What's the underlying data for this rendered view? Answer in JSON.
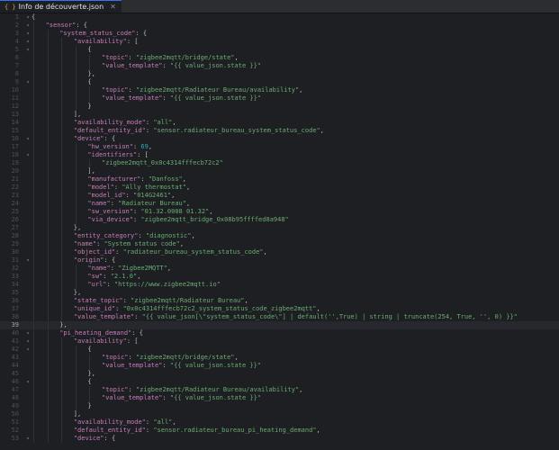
{
  "tab": {
    "icon": "{ }",
    "title": "Info de découverte.json",
    "close": "✕"
  },
  "editor": {
    "current_line": 39,
    "lines": [
      {
        "n": 1,
        "fold": "▾",
        "indent": 0,
        "tokens": [
          [
            "p",
            "{"
          ]
        ]
      },
      {
        "n": 2,
        "fold": "▾",
        "indent": 1,
        "tokens": [
          [
            "k",
            "\"sensor\""
          ],
          [
            "p",
            ": {"
          ]
        ]
      },
      {
        "n": 3,
        "fold": "▾",
        "indent": 2,
        "tokens": [
          [
            "k",
            "\"system_status_code\""
          ],
          [
            "p",
            ": {"
          ]
        ]
      },
      {
        "n": 4,
        "fold": "▾",
        "indent": 3,
        "tokens": [
          [
            "k",
            "\"availability\""
          ],
          [
            "p",
            ": ["
          ]
        ]
      },
      {
        "n": 5,
        "fold": "▾",
        "indent": 4,
        "tokens": [
          [
            "p",
            "{"
          ]
        ]
      },
      {
        "n": 6,
        "fold": "",
        "indent": 5,
        "tokens": [
          [
            "k",
            "\"topic\""
          ],
          [
            "p",
            ": "
          ],
          [
            "s",
            "\"zigbee2mqtt/bridge/state\""
          ],
          [
            "p",
            ","
          ]
        ]
      },
      {
        "n": 7,
        "fold": "",
        "indent": 5,
        "tokens": [
          [
            "k",
            "\"value_template\""
          ],
          [
            "p",
            ": "
          ],
          [
            "s",
            "\"{{ value_json.state }}\""
          ]
        ]
      },
      {
        "n": 8,
        "fold": "",
        "indent": 4,
        "tokens": [
          [
            "p",
            "},"
          ]
        ]
      },
      {
        "n": 9,
        "fold": "▾",
        "indent": 4,
        "tokens": [
          [
            "p",
            "{"
          ]
        ]
      },
      {
        "n": 10,
        "fold": "",
        "indent": 5,
        "tokens": [
          [
            "k",
            "\"topic\""
          ],
          [
            "p",
            ": "
          ],
          [
            "s",
            "\"zigbee2mqtt/Radiateur Bureau/availability\""
          ],
          [
            "p",
            ","
          ]
        ]
      },
      {
        "n": 11,
        "fold": "",
        "indent": 5,
        "tokens": [
          [
            "k",
            "\"value_template\""
          ],
          [
            "p",
            ": "
          ],
          [
            "s",
            "\"{{ value_json.state }}\""
          ]
        ]
      },
      {
        "n": 12,
        "fold": "",
        "indent": 4,
        "tokens": [
          [
            "p",
            "}"
          ]
        ]
      },
      {
        "n": 13,
        "fold": "",
        "indent": 3,
        "tokens": [
          [
            "p",
            "],"
          ]
        ]
      },
      {
        "n": 14,
        "fold": "",
        "indent": 3,
        "tokens": [
          [
            "k",
            "\"availability_mode\""
          ],
          [
            "p",
            ": "
          ],
          [
            "s",
            "\"all\""
          ],
          [
            "p",
            ","
          ]
        ]
      },
      {
        "n": 15,
        "fold": "",
        "indent": 3,
        "tokens": [
          [
            "k",
            "\"default_entity_id\""
          ],
          [
            "p",
            ": "
          ],
          [
            "s",
            "\"sensor.radiateur_bureau_system_status_code\""
          ],
          [
            "p",
            ","
          ]
        ]
      },
      {
        "n": 16,
        "fold": "▾",
        "indent": 3,
        "tokens": [
          [
            "k",
            "\"device\""
          ],
          [
            "p",
            ": {"
          ]
        ]
      },
      {
        "n": 17,
        "fold": "",
        "indent": 4,
        "tokens": [
          [
            "k",
            "\"hw_version\""
          ],
          [
            "p",
            ": "
          ],
          [
            "n",
            "69"
          ],
          [
            "p",
            ","
          ]
        ]
      },
      {
        "n": 18,
        "fold": "▾",
        "indent": 4,
        "tokens": [
          [
            "k",
            "\"identifiers\""
          ],
          [
            "p",
            ": ["
          ]
        ]
      },
      {
        "n": 19,
        "fold": "",
        "indent": 5,
        "tokens": [
          [
            "s",
            "\"zigbee2mqtt_0x0c4314fffecb72c2\""
          ]
        ]
      },
      {
        "n": 20,
        "fold": "",
        "indent": 4,
        "tokens": [
          [
            "p",
            "],"
          ]
        ]
      },
      {
        "n": 21,
        "fold": "",
        "indent": 4,
        "tokens": [
          [
            "k",
            "\"manufacturer\""
          ],
          [
            "p",
            ": "
          ],
          [
            "s",
            "\"Danfoss\""
          ],
          [
            "p",
            ","
          ]
        ]
      },
      {
        "n": 22,
        "fold": "",
        "indent": 4,
        "tokens": [
          [
            "k",
            "\"model\""
          ],
          [
            "p",
            ": "
          ],
          [
            "s",
            "\"Ally thermostat\""
          ],
          [
            "p",
            ","
          ]
        ]
      },
      {
        "n": 23,
        "fold": "",
        "indent": 4,
        "tokens": [
          [
            "k",
            "\"model_id\""
          ],
          [
            "p",
            ": "
          ],
          [
            "s",
            "\"014G2461\""
          ],
          [
            "p",
            ","
          ]
        ]
      },
      {
        "n": 24,
        "fold": "",
        "indent": 4,
        "tokens": [
          [
            "k",
            "\"name\""
          ],
          [
            "p",
            ": "
          ],
          [
            "s",
            "\"Radiateur Bureau\""
          ],
          [
            "p",
            ","
          ]
        ]
      },
      {
        "n": 25,
        "fold": "",
        "indent": 4,
        "tokens": [
          [
            "k",
            "\"sw_version\""
          ],
          [
            "p",
            ": "
          ],
          [
            "s",
            "\"01.32.0008 01.32\""
          ],
          [
            "p",
            ","
          ]
        ]
      },
      {
        "n": 26,
        "fold": "",
        "indent": 4,
        "tokens": [
          [
            "k",
            "\"via_device\""
          ],
          [
            "p",
            ": "
          ],
          [
            "s",
            "\"zigbee2mqtt_bridge_0x08b95ffffed8a948\""
          ]
        ]
      },
      {
        "n": 27,
        "fold": "",
        "indent": 3,
        "tokens": [
          [
            "p",
            "},"
          ]
        ]
      },
      {
        "n": 28,
        "fold": "",
        "indent": 3,
        "tokens": [
          [
            "k",
            "\"entity_category\""
          ],
          [
            "p",
            ": "
          ],
          [
            "s",
            "\"diagnostic\""
          ],
          [
            "p",
            ","
          ]
        ]
      },
      {
        "n": 29,
        "fold": "",
        "indent": 3,
        "tokens": [
          [
            "k",
            "\"name\""
          ],
          [
            "p",
            ": "
          ],
          [
            "s",
            "\"System status code\""
          ],
          [
            "p",
            ","
          ]
        ]
      },
      {
        "n": 30,
        "fold": "",
        "indent": 3,
        "tokens": [
          [
            "k",
            "\"object_id\""
          ],
          [
            "p",
            ": "
          ],
          [
            "s",
            "\"radiateur_bureau_system_status_code\""
          ],
          [
            "p",
            ","
          ]
        ]
      },
      {
        "n": 31,
        "fold": "▾",
        "indent": 3,
        "tokens": [
          [
            "k",
            "\"origin\""
          ],
          [
            "p",
            ": {"
          ]
        ]
      },
      {
        "n": 32,
        "fold": "",
        "indent": 4,
        "tokens": [
          [
            "k",
            "\"name\""
          ],
          [
            "p",
            ": "
          ],
          [
            "s",
            "\"Zigbee2MQTT\""
          ],
          [
            "p",
            ","
          ]
        ]
      },
      {
        "n": 33,
        "fold": "",
        "indent": 4,
        "tokens": [
          [
            "k",
            "\"sw\""
          ],
          [
            "p",
            ": "
          ],
          [
            "s",
            "\"2.1.0\""
          ],
          [
            "p",
            ","
          ]
        ]
      },
      {
        "n": 34,
        "fold": "",
        "indent": 4,
        "tokens": [
          [
            "k",
            "\"url\""
          ],
          [
            "p",
            ": "
          ],
          [
            "s",
            "\"https://www.zigbee2mqtt.io\""
          ]
        ]
      },
      {
        "n": 35,
        "fold": "",
        "indent": 3,
        "tokens": [
          [
            "p",
            "},"
          ]
        ]
      },
      {
        "n": 36,
        "fold": "",
        "indent": 3,
        "tokens": [
          [
            "k",
            "\"state_topic\""
          ],
          [
            "p",
            ": "
          ],
          [
            "s",
            "\"zigbee2mqtt/Radiateur Bureau\""
          ],
          [
            "p",
            ","
          ]
        ]
      },
      {
        "n": 37,
        "fold": "",
        "indent": 3,
        "tokens": [
          [
            "k",
            "\"unique_id\""
          ],
          [
            "p",
            ": "
          ],
          [
            "s",
            "\"0x0c4314fffecb72c2_system_status_code_zigbee2mqtt\""
          ],
          [
            "p",
            ","
          ]
        ]
      },
      {
        "n": 38,
        "fold": "",
        "indent": 3,
        "tokens": [
          [
            "k",
            "\"value_template\""
          ],
          [
            "p",
            ": "
          ],
          [
            "s",
            "\"{{ value_json[\\\"system_status_code\\\"] | default('',True) | string | truncate(254, True, '', 0) }}\""
          ]
        ]
      },
      {
        "n": 39,
        "fold": "",
        "indent": 2,
        "tokens": [
          [
            "p",
            "},"
          ]
        ]
      },
      {
        "n": 40,
        "fold": "▾",
        "indent": 2,
        "tokens": [
          [
            "k",
            "\"pi_heating_demand\""
          ],
          [
            "p",
            ": {"
          ]
        ]
      },
      {
        "n": 41,
        "fold": "▾",
        "indent": 3,
        "tokens": [
          [
            "k",
            "\"availability\""
          ],
          [
            "p",
            ": ["
          ]
        ]
      },
      {
        "n": 42,
        "fold": "▾",
        "indent": 4,
        "tokens": [
          [
            "p",
            "{"
          ]
        ]
      },
      {
        "n": 43,
        "fold": "",
        "indent": 5,
        "tokens": [
          [
            "k",
            "\"topic\""
          ],
          [
            "p",
            ": "
          ],
          [
            "s",
            "\"zigbee2mqtt/bridge/state\""
          ],
          [
            "p",
            ","
          ]
        ]
      },
      {
        "n": 44,
        "fold": "",
        "indent": 5,
        "tokens": [
          [
            "k",
            "\"value_template\""
          ],
          [
            "p",
            ": "
          ],
          [
            "s",
            "\"{{ value_json.state }}\""
          ]
        ]
      },
      {
        "n": 45,
        "fold": "",
        "indent": 4,
        "tokens": [
          [
            "p",
            "},"
          ]
        ]
      },
      {
        "n": 46,
        "fold": "▾",
        "indent": 4,
        "tokens": [
          [
            "p",
            "{"
          ]
        ]
      },
      {
        "n": 47,
        "fold": "",
        "indent": 5,
        "tokens": [
          [
            "k",
            "\"topic\""
          ],
          [
            "p",
            ": "
          ],
          [
            "s",
            "\"zigbee2mqtt/Radiateur Bureau/availability\""
          ],
          [
            "p",
            ","
          ]
        ]
      },
      {
        "n": 48,
        "fold": "",
        "indent": 5,
        "tokens": [
          [
            "k",
            "\"value_template\""
          ],
          [
            "p",
            ": "
          ],
          [
            "s",
            "\"{{ value_json.state }}\""
          ]
        ]
      },
      {
        "n": 49,
        "fold": "",
        "indent": 4,
        "tokens": [
          [
            "p",
            "}"
          ]
        ]
      },
      {
        "n": 50,
        "fold": "",
        "indent": 3,
        "tokens": [
          [
            "p",
            "],"
          ]
        ]
      },
      {
        "n": 51,
        "fold": "",
        "indent": 3,
        "tokens": [
          [
            "k",
            "\"availability_mode\""
          ],
          [
            "p",
            ": "
          ],
          [
            "s",
            "\"all\""
          ],
          [
            "p",
            ","
          ]
        ]
      },
      {
        "n": 52,
        "fold": "",
        "indent": 3,
        "tokens": [
          [
            "k",
            "\"default_entity_id\""
          ],
          [
            "p",
            ": "
          ],
          [
            "s",
            "\"sensor.radiateur_bureau_pi_heating_demand\""
          ],
          [
            "p",
            ","
          ]
        ]
      },
      {
        "n": 53,
        "fold": "▾",
        "indent": 3,
        "tokens": [
          [
            "k",
            "\"device\""
          ],
          [
            "p",
            ": {"
          ]
        ]
      }
    ]
  }
}
